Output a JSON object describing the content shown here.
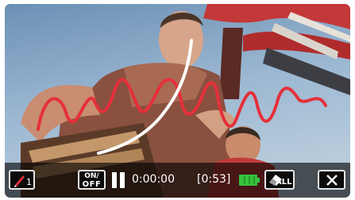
{
  "scene": {
    "description_name": "playback-video-frame",
    "sky_color": "#7fa3c4",
    "drawing_colors": {
      "red_line": "#e5303a",
      "white_line": "#ffffff"
    }
  },
  "controls": {
    "pen_button": {
      "icon": "pen-icon",
      "pen_color": "#e5303a",
      "count": "1"
    },
    "onoff_button": {
      "line1": "ON/",
      "line2": "OFF"
    },
    "pause_icon": "pause-icon",
    "elapsed_time": "0:00:00",
    "remaining_time": "[0:53]",
    "battery": {
      "icon": "battery-icon",
      "color": "#35c43c",
      "level": 1.0
    },
    "clear_all_button": {
      "icon": "eraser-icon",
      "label": "ALL"
    },
    "close_button": {
      "icon": "close-icon"
    }
  }
}
